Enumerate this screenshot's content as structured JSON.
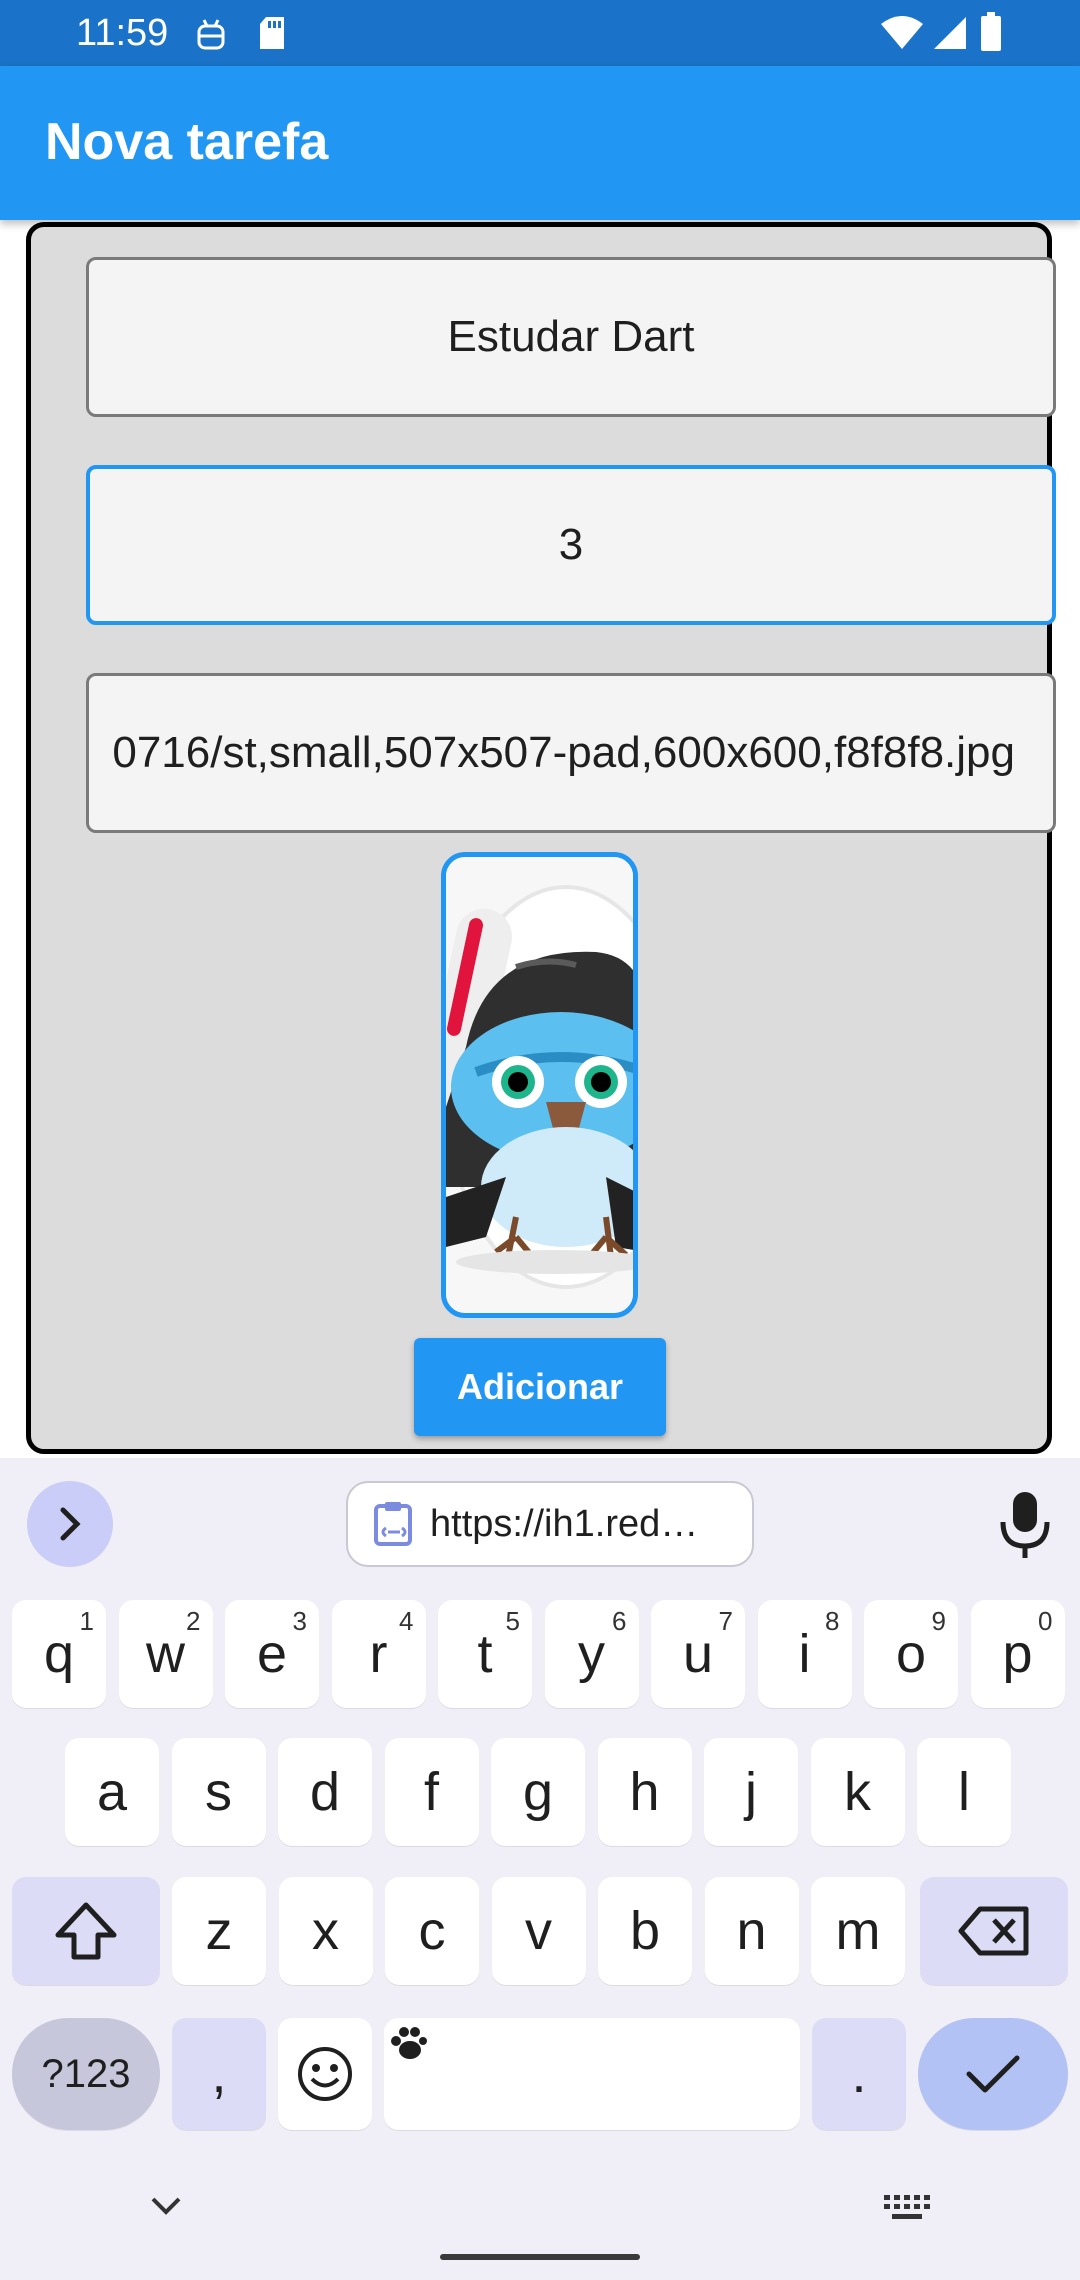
{
  "status_bar": {
    "time": "11:59",
    "left_icons": [
      "android-debug-icon",
      "sd-card-icon"
    ],
    "right_icons": [
      "wifi-icon",
      "signal-icon",
      "battery-icon"
    ]
  },
  "app_bar": {
    "title": "Nova tarefa"
  },
  "form": {
    "name_value": "Estudar Dart",
    "difficulty_value": "3",
    "image_url_value": "0716/st,small,507x507-pad,600x600,f8f8f8.jpg",
    "image_preview": "owl-with-lightsaber-sticker",
    "add_button_label": "Adicionar"
  },
  "keyboard": {
    "suggestion_chip": "https://ih1.red…",
    "row1": [
      {
        "k": "q",
        "h": "1"
      },
      {
        "k": "w",
        "h": "2"
      },
      {
        "k": "e",
        "h": "3"
      },
      {
        "k": "r",
        "h": "4"
      },
      {
        "k": "t",
        "h": "5"
      },
      {
        "k": "y",
        "h": "6"
      },
      {
        "k": "u",
        "h": "7"
      },
      {
        "k": "i",
        "h": "8"
      },
      {
        "k": "o",
        "h": "9"
      },
      {
        "k": "p",
        "h": "0"
      }
    ],
    "row2": [
      "a",
      "s",
      "d",
      "f",
      "g",
      "h",
      "j",
      "k",
      "l"
    ],
    "row3": [
      "z",
      "x",
      "c",
      "v",
      "b",
      "n",
      "m"
    ],
    "symbols_label": "?123",
    "comma_label": ",",
    "period_label": "."
  },
  "colors": {
    "primary": "#2196f3",
    "status_bar": "#1a73c8",
    "card_bg": "#dcdcdc"
  }
}
